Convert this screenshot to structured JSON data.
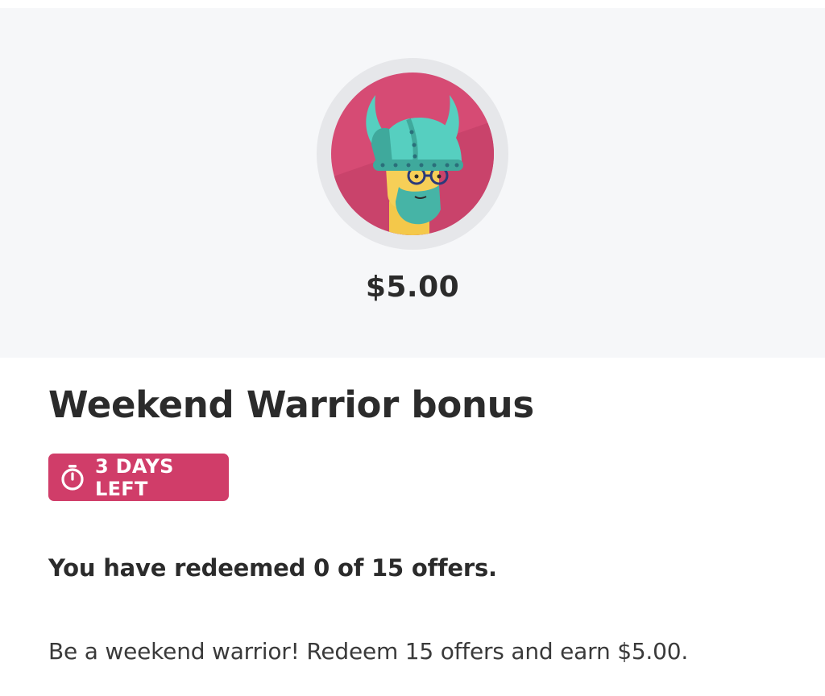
{
  "reward": {
    "amount": "$5.00",
    "badge_icon": "viking-warrior-icon"
  },
  "bonus": {
    "title": "Weekend Warrior bonus",
    "timer_icon": "stopwatch-icon",
    "time_left": "3 DAYS LEFT",
    "progress_text": "You have redeemed 0 of 15 offers.",
    "description": "Be a weekend warrior! Redeem 15 offers and earn $5.00."
  },
  "colors": {
    "accent": "#d03d69",
    "hero_background": "#f6f7f9",
    "badge_teal": "#56cfc0"
  }
}
